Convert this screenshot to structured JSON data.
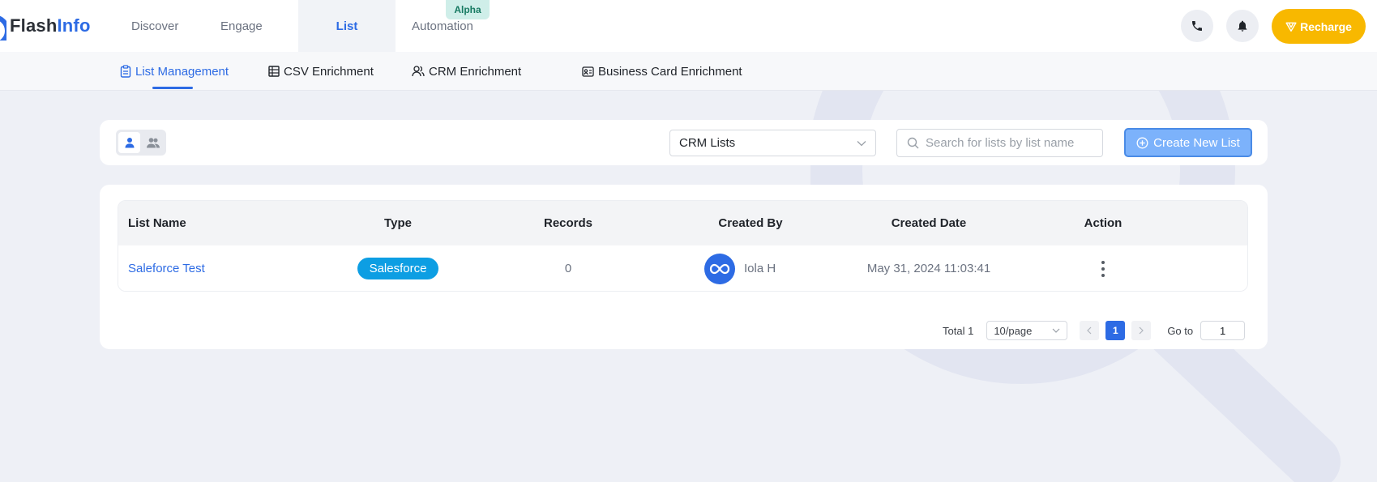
{
  "brand": {
    "part1": "Flash",
    "part2": "Info"
  },
  "nav": {
    "items": [
      {
        "label": "Discover"
      },
      {
        "label": "Engage"
      },
      {
        "label": "List"
      },
      {
        "label": "Automation"
      }
    ],
    "active": "List",
    "alpha_badge": "Alpha"
  },
  "header": {
    "recharge_label": "Recharge",
    "icons": [
      "phone-icon",
      "bell-icon",
      "diamond-icon"
    ]
  },
  "subnav": {
    "items": [
      {
        "label": "List Management",
        "icon": "clipboard-icon"
      },
      {
        "label": "CSV Enrichment",
        "icon": "table-icon"
      },
      {
        "label": "CRM Enrichment",
        "icon": "users-icon"
      },
      {
        "label": "Business Card Enrichment",
        "icon": "id-card-icon"
      }
    ],
    "active": "List Management"
  },
  "filters": {
    "list_type": "CRM Lists",
    "search_placeholder": "Search for lists by list name",
    "create_label": "Create New List"
  },
  "table": {
    "columns": [
      "List Name",
      "Type",
      "Records",
      "Created By",
      "Created Date",
      "Action"
    ],
    "rows": [
      {
        "name": "Saleforce Test",
        "type": "Salesforce",
        "records": "0",
        "created_by": "Iola H",
        "created_date": "May 31, 2024 11:03:41"
      }
    ]
  },
  "pagination": {
    "total": "Total 1",
    "page_size": "10/page",
    "current_page": "1",
    "goto_label": "Go to",
    "goto_value": "1"
  },
  "colors": {
    "primary": "#2d6be4",
    "salesforce": "#0d9ee3",
    "recharge": "#f8b800",
    "alpha_bg": "#cfeee9"
  }
}
